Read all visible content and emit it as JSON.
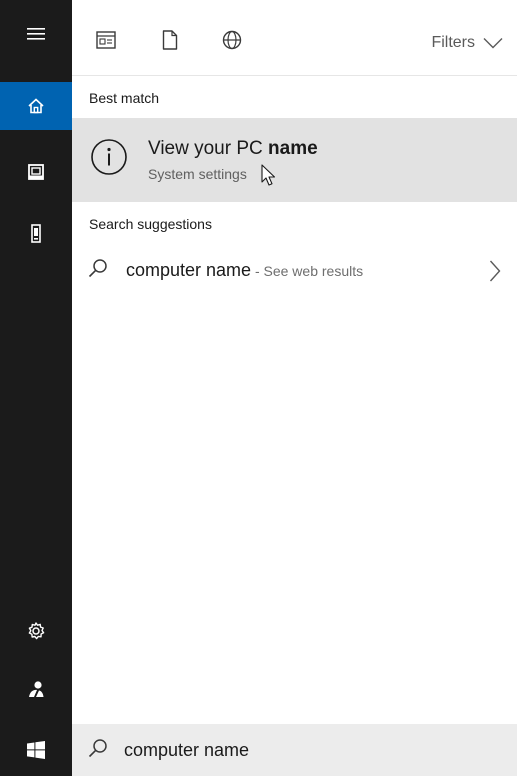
{
  "toolbar": {
    "icons": [
      "apps-icon",
      "documents-icon",
      "web-icon"
    ],
    "filters_label": "Filters"
  },
  "rail": {
    "items": [
      "hamburger-icon",
      "home-icon",
      "documents-icon",
      "device-icon",
      "settings-icon",
      "user-icon",
      "windows-start-icon"
    ]
  },
  "results": {
    "best_match_heading": "Best match",
    "best_match": {
      "title_prefix": "View your PC ",
      "title_bold": "name",
      "subtitle": "System settings",
      "icon": "info-icon"
    },
    "suggestions_heading": "Search suggestions",
    "suggestions": [
      {
        "query": "computer name",
        "suffix": " - See web results"
      }
    ]
  },
  "search": {
    "value": "computer name",
    "icon": "search-icon"
  },
  "colors": {
    "rail": "#1b1b1b",
    "accent": "#0063b1",
    "highlight": "#e2e2e2",
    "searchbox": "#ececec"
  }
}
